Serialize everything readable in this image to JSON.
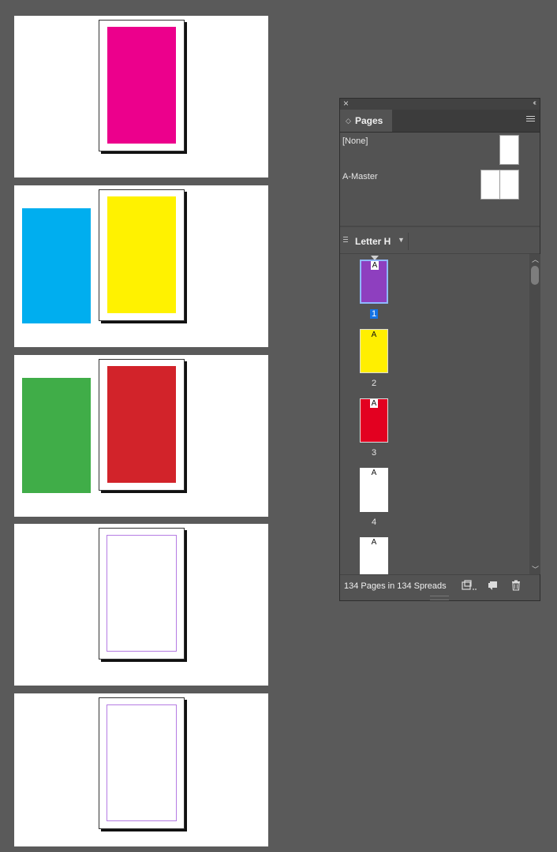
{
  "canvas": {
    "spreads": [
      {
        "type": "single",
        "fill_color": "#ec008c"
      },
      {
        "type": "pair",
        "left_color": "#00aeef",
        "fill_color": "#fff200"
      },
      {
        "type": "pair",
        "left_color": "#40ad48",
        "fill_color": "#d2232a"
      },
      {
        "type": "blank"
      },
      {
        "type": "blank"
      }
    ]
  },
  "panel": {
    "close_glyph": "×",
    "collapse_glyph": "‹‹",
    "tab_label": "Pages",
    "masters": [
      {
        "label": "[None]"
      },
      {
        "label": "A-Master"
      }
    ],
    "page_size_label": "Letter H",
    "pages": [
      {
        "number": "1",
        "master": "A",
        "color": "#8e3fbf",
        "selected": true
      },
      {
        "number": "2",
        "master": "A",
        "color": "#ffef00",
        "selected": false
      },
      {
        "number": "3",
        "master": "A",
        "color": "#e30020",
        "selected": false
      },
      {
        "number": "4",
        "master": "A",
        "color": "#ffffff",
        "selected": false
      },
      {
        "number": "",
        "master": "A",
        "color": "#ffffff",
        "selected": false
      }
    ],
    "footer_text": "134 Pages in 134 Spreads"
  }
}
